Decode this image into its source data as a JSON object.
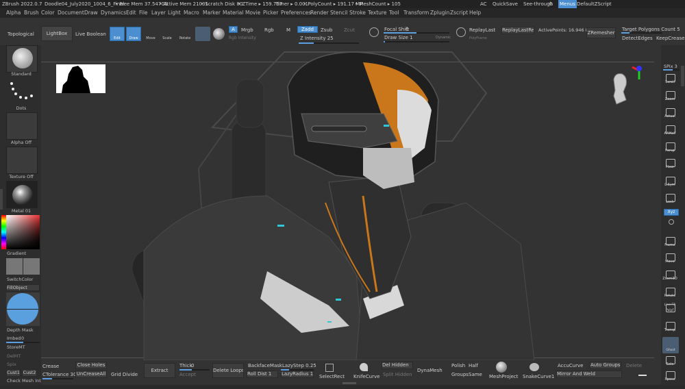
{
  "app": {
    "version": "ZBrush 2022.0.7",
    "document": "Doodle04_July2020_1004_6_Final",
    "free_mem": "• Free Mem 37.547GB",
    "active_mem": "• Active Mem 21031",
    "scratch": "• Scratch Disk 80",
    "ztime": "• ZTime ▸ 159.767",
    "timer": "Timer ▸ 0.001",
    "polycount": "• PolyCount ▸ 191.17 MP",
    "meshcount": "• MeshCount ▸ 105",
    "ac": "AC",
    "quicksave": "QuickSave",
    "see_through": "See-through",
    "see_through_val": "0",
    "menus": "Menus",
    "default_zscript": "DefaultZScript"
  },
  "menus": [
    "Alpha",
    "Brush",
    "Color",
    "Document",
    "Draw",
    "Dynamics",
    "Edit",
    "File",
    "Layer",
    "Light",
    "Macro",
    "Marker",
    "Material",
    "Movie",
    "Picker",
    "Preferences",
    "Render",
    "Stencil",
    "Stroke",
    "Texture",
    "Tool",
    "Transform",
    "Zplugin",
    "Zscript",
    "Help"
  ],
  "top": {
    "topological": "Topological",
    "lightbox": "LightBox",
    "live_boolean": "Live Boolean",
    "edit": "Edit",
    "draw": "Draw",
    "move": "Move",
    "scale": "Scale",
    "rotate": "Rotate",
    "a": "A",
    "mrgb": "Mrgb",
    "rgb": "Rgb",
    "m": "M",
    "zadd": "Zadd",
    "zsub": "Zsub",
    "zcut": "Zcut",
    "rgb_intensity": "Rgb Intensity",
    "z_intensity": "Z Intensity 25",
    "focal_shift": "Focal Shift",
    "focal_shift_val": "0",
    "draw_size": "Draw Size 1",
    "dynamic": "Dynamic",
    "replay_last": "ReplayLast",
    "replay_last_rel": "ReplayLastRel",
    "polyf": "PolyFrame",
    "active_points": "ActivePoints: 16.946 Mil",
    "zremesher": "ZRemesher",
    "target_polygons": "Target Polygons Count 5",
    "detect_edges": "DetectEdges",
    "keep_creases": "KeepCreases"
  },
  "left": {
    "standard": "Standard",
    "dots": "Dots",
    "alpha_off": "Alpha Off",
    "texture_off": "Texture Off",
    "matcap": "Metal 01",
    "gradient": "Gradient",
    "switch_color": "SwitchColor",
    "fill_object": "FillObject",
    "depth_mask": "Depth Mask",
    "imbed": "Imbed",
    "imbed_val": "0",
    "store_mt": "StoreMT",
    "del_mt": "DelMT",
    "spix": "Spix",
    "cust1": "Cust1",
    "cust2": "Cust2",
    "check_mesh": "Check Mesh Int"
  },
  "right": {
    "spix": "SPix 3",
    "items": [
      "Scroll",
      "Zoom",
      "Actual",
      "AAHalf",
      "Persp",
      "Floor",
      "L.Sym",
      "Lock",
      "Xyz",
      "",
      "Frame",
      "Move",
      "Zoom3D",
      "Rotate",
      "Line Fill PolyF",
      "Transp",
      "Ghost",
      "Solo",
      "Xpose"
    ]
  },
  "bottom": {
    "crease": "Crease",
    "ctolerance": "CTolerance 30",
    "close_holes": "Close Holes",
    "uncrease_all": "UnCreaseAll",
    "grid_divide": "Grid Divide",
    "extract": "Extract",
    "thick": "Thick",
    "thick_val": "0",
    "accept": "Accept",
    "delete_loops": "Delete Loops",
    "backface_mask": "BackfaceMask",
    "roll_dist": "Roll Dist 1",
    "lazystep": "LazyStep 0.25",
    "lazyradius": "LazyRadius 1",
    "select_rect": "SelectRect",
    "knife_curve": "KnifeCurve",
    "del_hidden": "Del Hidden",
    "split_hidden": "Split Hidden",
    "dynamesh": "DynaMesh",
    "polish": "Polish",
    "groups": "Groups",
    "half": "Half",
    "same": "Same",
    "mesh_project": "MeshProject",
    "snake_curve": "SnakeCurve1",
    "accu_curve": "AccuCurve",
    "auto_groups": "Auto Groups",
    "delete": "Delete",
    "mirror_and_weld": "Mirror And Weld"
  },
  "colors": {
    "accent": "#4b8fd1",
    "orange": "#c9771a",
    "cyan": "#2ec8d8"
  }
}
